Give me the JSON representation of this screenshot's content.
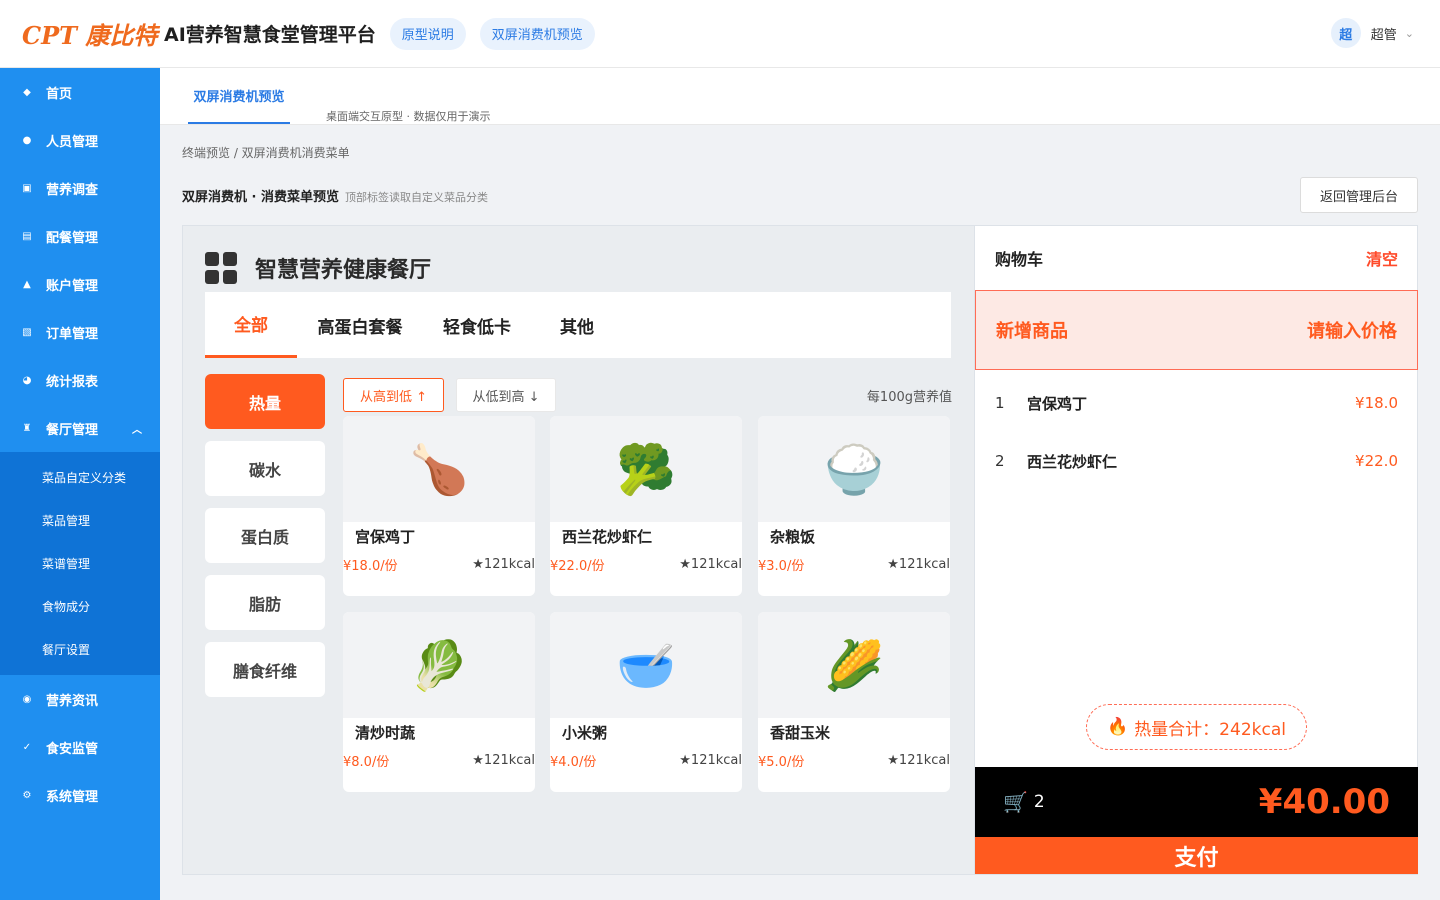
{
  "header": {
    "logo": "CPT 康比特",
    "app_title": "AI营养智慧食堂管理平台",
    "pills": [
      "原型说明",
      "双屏消费机预览"
    ],
    "user": {
      "avatar": "超",
      "name": "超管"
    }
  },
  "sidebar": {
    "items": [
      {
        "label": "首页",
        "icon": "diamond-icon",
        "glyph": "◆"
      },
      {
        "label": "人员管理",
        "icon": "dot-icon",
        "glyph": "●"
      },
      {
        "label": "营养调查",
        "icon": "square-icon",
        "glyph": "▣"
      },
      {
        "label": "配餐管理",
        "icon": "list-icon",
        "glyph": "▤"
      },
      {
        "label": "账户管理",
        "icon": "triangle-icon",
        "glyph": "▲"
      },
      {
        "label": "订单管理",
        "icon": "grid-icon",
        "glyph": "▧"
      },
      {
        "label": "统计报表",
        "icon": "chart-icon",
        "glyph": "◕"
      },
      {
        "label": "餐厅管理",
        "icon": "restaurant-icon",
        "glyph": "♜"
      },
      {
        "label": "营养资讯",
        "icon": "circle-icon",
        "glyph": "◉"
      },
      {
        "label": "食安监管",
        "icon": "check-icon",
        "glyph": "✓"
      },
      {
        "label": "系统管理",
        "icon": "gear-icon",
        "glyph": "⚙"
      }
    ],
    "sub_items": [
      "菜品自定义分类",
      "菜品管理",
      "菜谱管理",
      "食物成分",
      "餐厅设置"
    ]
  },
  "tabbar": {
    "active_tab": "双屏消费机预览",
    "note": "桌面端交互原型 · 数据仅用于演示"
  },
  "breadcrumb": "终端预览 / 双屏消费机消费菜单",
  "section": {
    "title": "双屏消费机 · 消费菜单预览",
    "subtitle": "顶部标签读取自定义菜品分类",
    "back_button": "返回管理后台"
  },
  "kiosk": {
    "store_name": "智慧营养健康餐厅",
    "categories": [
      "全部",
      "高蛋白套餐",
      "轻食低卡",
      "其他"
    ],
    "active_category": "全部",
    "nutrients": [
      "热量",
      "碳水",
      "蛋白质",
      "脂肪",
      "膳食纤维"
    ],
    "active_nutrient": "热量",
    "sort": {
      "desc": "从高到低 ↑",
      "asc": "从低到高 ↓"
    },
    "per100": "每100g营养值",
    "dishes": [
      {
        "name": "宫保鸡丁",
        "price": "¥18.0/份",
        "cal": "★121kcal",
        "emoji": "🍗",
        "icon": "drumstick-icon"
      },
      {
        "name": "西兰花炒虾仁",
        "price": "¥22.0/份",
        "cal": "★121kcal",
        "emoji": "🥦",
        "icon": "broccoli-icon"
      },
      {
        "name": "杂粮饭",
        "price": "¥3.0/份",
        "cal": "★121kcal",
        "emoji": "🍚",
        "icon": "rice-icon"
      },
      {
        "name": "清炒时蔬",
        "price": "¥8.0/份",
        "cal": "★121kcal",
        "emoji": "🥬",
        "icon": "greens-icon"
      },
      {
        "name": "小米粥",
        "price": "¥4.0/份",
        "cal": "★121kcal",
        "emoji": "🥣",
        "icon": "bowl-icon"
      },
      {
        "name": "香甜玉米",
        "price": "¥5.0/份",
        "cal": "★121kcal",
        "emoji": "🌽",
        "icon": "corn-icon"
      }
    ]
  },
  "cart": {
    "title": "购物车",
    "clear": "清空",
    "new_item": "新增商品",
    "price_prompt": "请输入价格",
    "items": [
      {
        "idx": "1",
        "name": "宫保鸡丁",
        "price": "¥18.0"
      },
      {
        "idx": "2",
        "name": "西兰花炒虾仁",
        "price": "¥22.0"
      }
    ],
    "calorie_total": "热量合计：242kcal",
    "count": "2",
    "total": "¥40.00",
    "pay": "支付"
  }
}
